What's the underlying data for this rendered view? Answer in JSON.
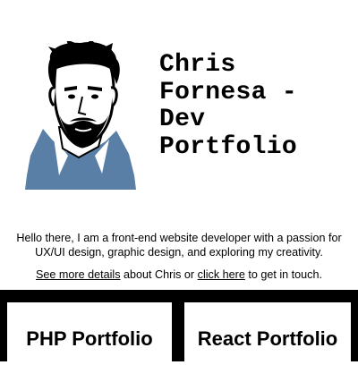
{
  "header": {
    "title": "Chris Fornesa - Dev Portfolio",
    "title_lines": [
      "Chris",
      "Fornesa -",
      "Dev",
      "Portfolio"
    ]
  },
  "avatar": {
    "icon": "portrait-illustration-icon"
  },
  "intro": {
    "text": "Hello there, I am a front-end website developer with a passion for UX/UI design, graphic design, and exploring my creativity.",
    "details_link": "See more details",
    "middle_text": " about Chris or ",
    "contact_link": "click here",
    "end_text": " to get in touch."
  },
  "portfolio": {
    "cards": [
      {
        "label": "PHP Portfolio"
      },
      {
        "label": "React Portfolio"
      }
    ]
  },
  "colors": {
    "background": "#ffffff",
    "text": "#000000",
    "shirt": "#5a7fa6",
    "band": "#000000"
  }
}
